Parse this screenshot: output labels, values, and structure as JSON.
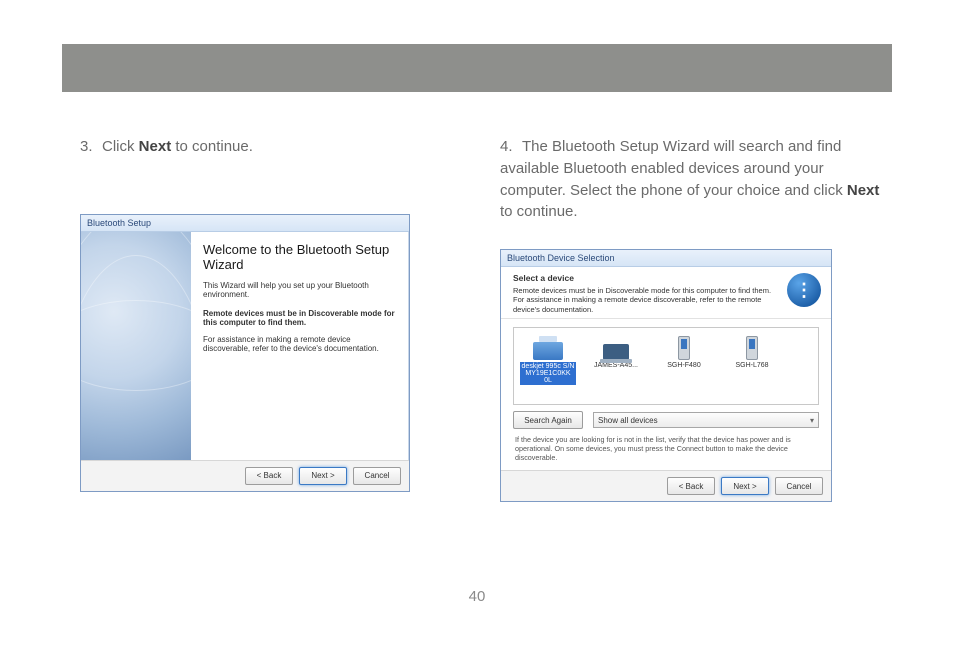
{
  "page_number": "40",
  "step3": {
    "number": "3.",
    "pre": "Click ",
    "bold": "Next",
    "post": " to continue."
  },
  "step4": {
    "number": "4.",
    "pre": "The Bluetooth Setup Wizard will search and find available Bluetooth enabled devices around your computer.  Select the phone of your choice and click ",
    "bold": "Next",
    "post": " to continue."
  },
  "dlg1": {
    "title": "Bluetooth Setup",
    "heading": "Welcome to the Bluetooth Setup Wizard",
    "p1": "This Wizard will help you set up your Bluetooth environment.",
    "strong": "Remote devices must be in Discoverable mode for this computer to find them.",
    "p2": "For assistance in making a remote device discoverable, refer to the device's documentation.",
    "back": "< Back",
    "next": "Next >",
    "cancel": "Cancel"
  },
  "dlg2": {
    "title": "Bluetooth Device Selection",
    "subhead": "Select a device",
    "subdesc": "Remote devices must be in Discoverable mode for this computer to find them. For assistance in making a remote device discoverable, refer to the remote device's documentation.",
    "devices": [
      {
        "name": "deskjet 995c S/N MY19E1C0KK 0L"
      },
      {
        "name": "JAMES-A45..."
      },
      {
        "name": "SGH-F480"
      },
      {
        "name": "SGH-L768"
      }
    ],
    "search_again": "Search Again",
    "filter": "Show all devices",
    "note": "If the device you are looking for is not in the list, verify that the device has power and is operational. On some devices, you must press the Connect button to make the device discoverable.",
    "back": "< Back",
    "next": "Next >",
    "cancel": "Cancel"
  }
}
